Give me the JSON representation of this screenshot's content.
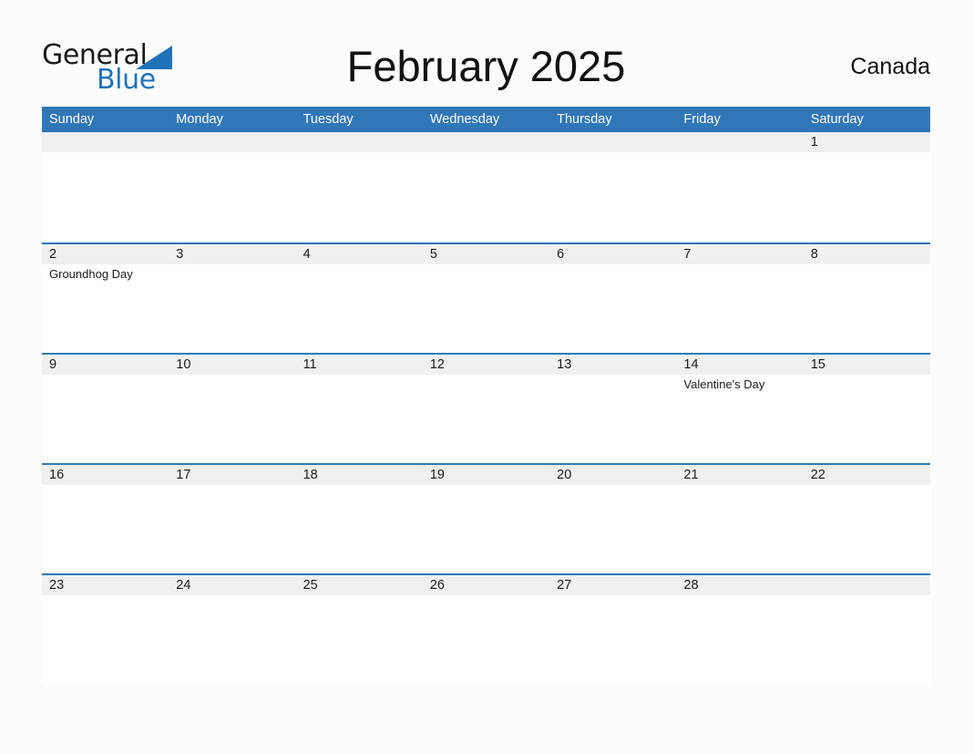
{
  "logo": {
    "word_one": "General",
    "word_two": "Blue",
    "triangle_color": "#1f72b8"
  },
  "header": {
    "title": "February 2025",
    "region": "Canada"
  },
  "theme": {
    "header_blue": "#3077b8",
    "band_gray": "#f0f0f0",
    "page_background": "#fcfcfd",
    "text": "#1b1b1b"
  },
  "calendar": {
    "month": "February",
    "year": "2025",
    "weekday_headers": [
      "Sunday",
      "Monday",
      "Tuesday",
      "Wednesday",
      "Thursday",
      "Friday",
      "Saturday"
    ],
    "weeks": [
      [
        {
          "day": "",
          "event": ""
        },
        {
          "day": "",
          "event": ""
        },
        {
          "day": "",
          "event": ""
        },
        {
          "day": "",
          "event": ""
        },
        {
          "day": "",
          "event": ""
        },
        {
          "day": "",
          "event": ""
        },
        {
          "day": "1",
          "event": ""
        }
      ],
      [
        {
          "day": "2",
          "event": "Groundhog Day"
        },
        {
          "day": "3",
          "event": ""
        },
        {
          "day": "4",
          "event": ""
        },
        {
          "day": "5",
          "event": ""
        },
        {
          "day": "6",
          "event": ""
        },
        {
          "day": "7",
          "event": ""
        },
        {
          "day": "8",
          "event": ""
        }
      ],
      [
        {
          "day": "9",
          "event": ""
        },
        {
          "day": "10",
          "event": ""
        },
        {
          "day": "11",
          "event": ""
        },
        {
          "day": "12",
          "event": ""
        },
        {
          "day": "13",
          "event": ""
        },
        {
          "day": "14",
          "event": "Valentine's Day"
        },
        {
          "day": "15",
          "event": ""
        }
      ],
      [
        {
          "day": "16",
          "event": ""
        },
        {
          "day": "17",
          "event": ""
        },
        {
          "day": "18",
          "event": ""
        },
        {
          "day": "19",
          "event": ""
        },
        {
          "day": "20",
          "event": ""
        },
        {
          "day": "21",
          "event": ""
        },
        {
          "day": "22",
          "event": ""
        }
      ],
      [
        {
          "day": "23",
          "event": ""
        },
        {
          "day": "24",
          "event": ""
        },
        {
          "day": "25",
          "event": ""
        },
        {
          "day": "26",
          "event": ""
        },
        {
          "day": "27",
          "event": ""
        },
        {
          "day": "28",
          "event": ""
        },
        {
          "day": "",
          "event": ""
        }
      ]
    ]
  }
}
